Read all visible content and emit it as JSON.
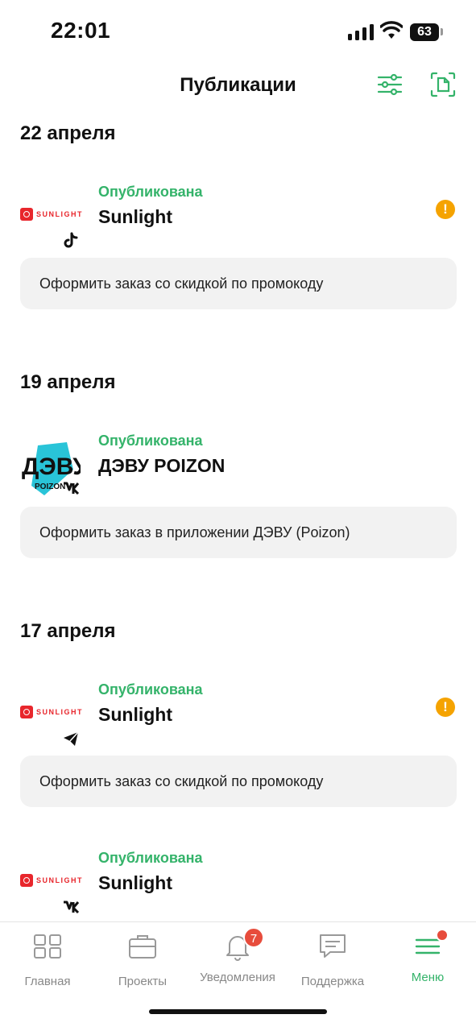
{
  "status_bar": {
    "time": "22:01",
    "battery": "63"
  },
  "header": {
    "title": "Публикации"
  },
  "sections": [
    {
      "date": "22 апреля",
      "post": {
        "status": "Опубликована",
        "brand": "Sunlight",
        "logo_text": "SUNLIGHT",
        "network_icon": "tiktok-icon",
        "warning": "!",
        "description": "Оформить заказ со скидкой по промокоду"
      }
    },
    {
      "date": "19 апреля",
      "post": {
        "status": "Опубликована",
        "brand": "ДЭВУ POIZON",
        "logo_text": "ДЭВУ",
        "logo_subtext": "POIZON",
        "network_icon": "vk-icon",
        "description": "Оформить заказ в приложении ДЭВУ (Poizon)"
      }
    },
    {
      "date": "17 апреля",
      "post": {
        "status": "Опубликована",
        "brand": "Sunlight",
        "logo_text": "SUNLIGHT",
        "network_icon": "telegram-icon",
        "warning": "!",
        "description": "Оформить заказ со скидкой по промокоду"
      }
    },
    {
      "date": "",
      "post": {
        "status": "Опубликована",
        "brand": "Sunlight",
        "logo_text": "SUNLIGHT",
        "network_icon": "vk-icon"
      }
    }
  ],
  "bottom_nav": {
    "items": [
      {
        "label": "Главная",
        "icon": "grid-icon"
      },
      {
        "label": "Проекты",
        "icon": "briefcase-icon"
      },
      {
        "label": "Уведомления",
        "icon": "bell-icon",
        "badge": "7"
      },
      {
        "label": "Поддержка",
        "icon": "chat-icon"
      },
      {
        "label": "Меню",
        "icon": "menu-icon",
        "active": true
      }
    ]
  },
  "colors": {
    "accent": "#34b36a",
    "warning": "#f5a300",
    "badge": "#e74c3c",
    "brand_red": "#e8262c",
    "dvu_cyan": "#29c4d8"
  }
}
